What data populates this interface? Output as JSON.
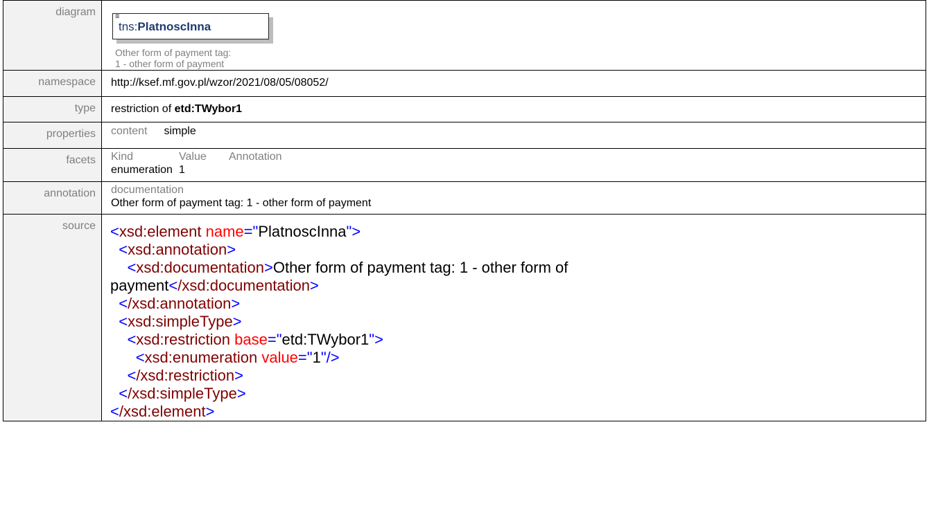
{
  "labels": {
    "diagram": "diagram",
    "namespace": "namespace",
    "type": "type",
    "properties": "properties",
    "facets": "facets",
    "annotation": "annotation",
    "source": "source"
  },
  "diagram": {
    "prefix": "tns:",
    "name": "PlatnoscInna",
    "doc_line1": "Other form of payment tag:",
    "doc_line2": "1 - other form of payment"
  },
  "namespace": "http://ksef.mf.gov.pl/wzor/2021/08/05/08052/",
  "type": {
    "prefix_text": "restriction of ",
    "base": "etd:TWybor1"
  },
  "properties": {
    "header": "content",
    "value": "simple"
  },
  "facets": {
    "headers": [
      "Kind",
      "Value",
      "Annotation"
    ],
    "rows": [
      [
        "enumeration",
        "1",
        ""
      ]
    ]
  },
  "annotation": {
    "header": "documentation",
    "text": "Other form of payment tag: 1 - other form of payment"
  },
  "source": {
    "l1_tag": "xsd:element",
    "l1_attr": "name",
    "l1_val": "PlatnoscInna",
    "l2_tag": "xsd:annotation",
    "l3_tag": "xsd:documentation",
    "l3_text": "Other form of payment tag: 1 - other form of",
    "l4_text": "payment",
    "l4_tag": "/xsd:documentation",
    "l5_tag": "/xsd:annotation",
    "l6_tag": "xsd:simpleType",
    "l7_tag": "xsd:restriction",
    "l7_attr": "base",
    "l7_val": "etd:TWybor1",
    "l8_tag": "xsd:enumeration",
    "l8_attr": "value",
    "l8_val": "1",
    "l9_tag": "/xsd:restriction",
    "l10_tag": "/xsd:simpleType",
    "l11_tag": "/xsd:element"
  },
  "colors": {
    "label_bg": "#f2f2f2",
    "label_text": "#7f7f7f",
    "tag": "#800000",
    "attribute": "#ff0000",
    "punctuation": "#0000ff",
    "diagram_name": "#1f3a6e"
  }
}
